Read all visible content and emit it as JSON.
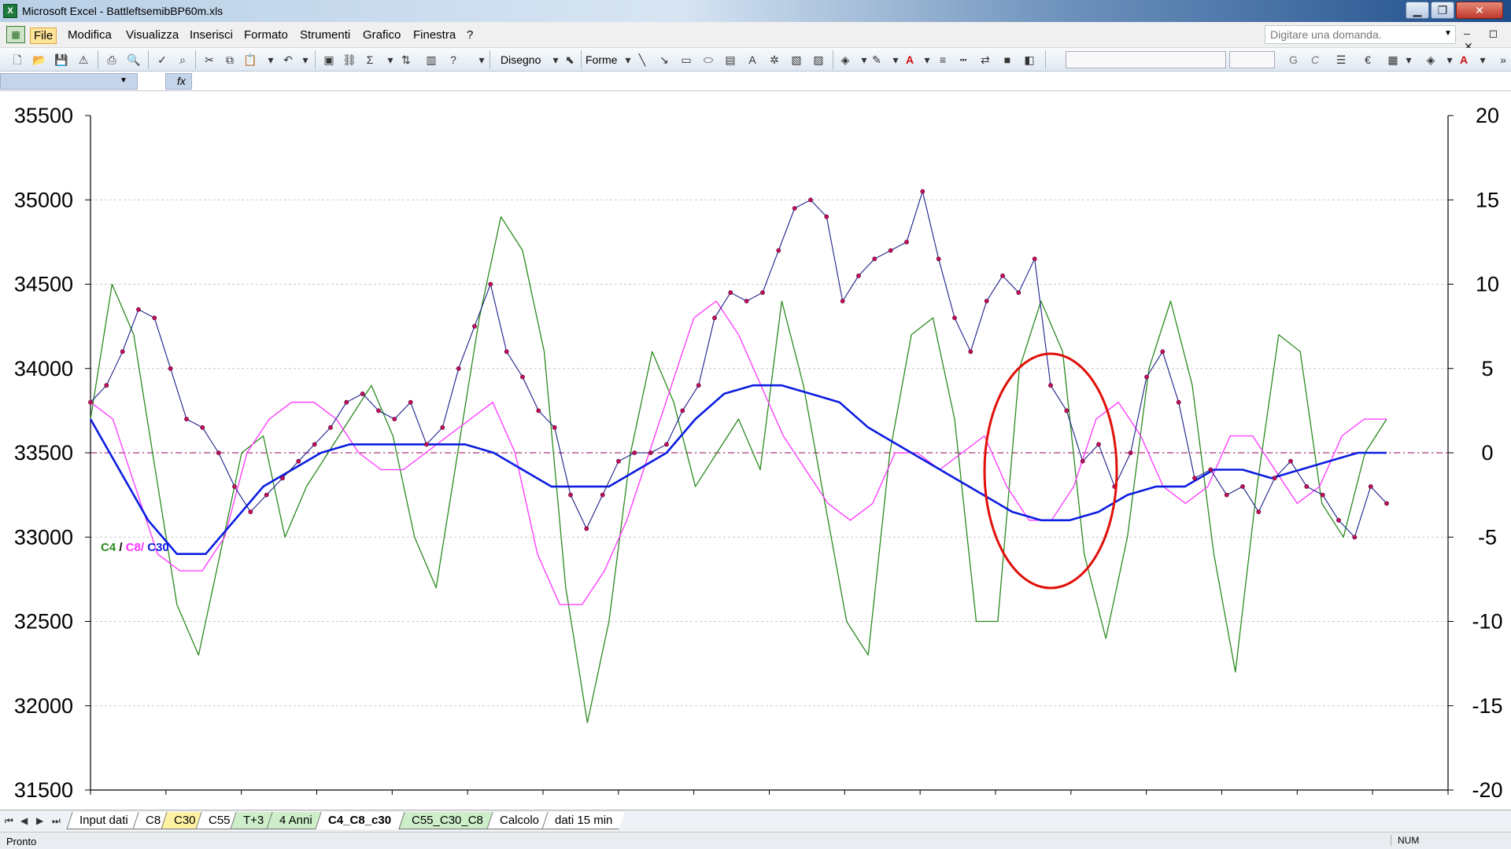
{
  "window": {
    "title": "Microsoft Excel - BattleftsemibBP60m.xls",
    "app_icon": "excel-icon",
    "controls": [
      "minimize-icon",
      "restore-icon",
      "close-icon"
    ]
  },
  "menubar": {
    "items": [
      "File",
      "Modifica",
      "Visualizza",
      "Inserisci",
      "Formato",
      "Strumenti",
      "Grafico",
      "Finestra",
      "?"
    ],
    "ask_placeholder": "Digitare una domanda.",
    "doc_controls": "– ◻ ✕"
  },
  "toolbar": {
    "draw_label": "Disegno",
    "shapes_label": "Forme",
    "bold_label": "G",
    "italic_label": "C"
  },
  "formulabar": {
    "fx_label": "fx"
  },
  "chart": {
    "type": "line",
    "ylim_left": [
      31500,
      35500
    ],
    "ylim_right": [
      -20,
      20
    ],
    "left_ticks": [
      "35500",
      "35000",
      "34500",
      "34000",
      "33500",
      "33000",
      "32500",
      "32000",
      "31500"
    ],
    "right_ticks": [
      "20",
      "15",
      "10",
      "5",
      "0",
      "-5",
      "-10",
      "-15",
      "-20"
    ],
    "legend": {
      "c4": "C4",
      "sep1": " / ",
      "c8": "C8/",
      "c30": " C30"
    },
    "colors": {
      "price": "#1c1f8a",
      "markers": "#c0105a",
      "c4": "#2a8a1e",
      "c8": "#ff33ff",
      "c30": "#0b1de0",
      "zero": "#a8347a",
      "circle": "#e0100a"
    },
    "grid": "horizontal dotted",
    "annotation": "red ellipse"
  },
  "chart_data": {
    "type": "line",
    "ylim": [
      31500,
      35500
    ],
    "y2lim": [
      -20,
      20
    ],
    "series": [
      {
        "axis": "left",
        "values": [
          33800,
          33900,
          34100,
          34350,
          34300,
          34000,
          33700,
          33650,
          33500,
          33300,
          33150,
          33250,
          33350,
          33450,
          33550,
          33650,
          33800,
          33850,
          33750,
          33700,
          33800,
          33550,
          33650,
          34000,
          34250,
          34500,
          34100,
          33950,
          33750,
          33650,
          33250,
          33050,
          33250,
          33450,
          33500,
          33500,
          33550,
          33750,
          33900,
          34300,
          34450,
          34400,
          34450,
          34700,
          34950,
          35000,
          34900,
          34400,
          34550,
          34650,
          34700,
          34750,
          35050,
          34650,
          34300,
          34100,
          34400,
          34550,
          34450,
          34650,
          33900,
          33750,
          33450,
          33550,
          33300,
          33500,
          33950,
          34100,
          33800,
          33350,
          33400,
          33250,
          33300,
          33150,
          33350,
          33450,
          33300,
          33250,
          33100,
          33000,
          33300,
          33200
        ]
      },
      {
        "name": "C4",
        "axis": "right",
        "values": [
          2,
          10,
          7,
          -1,
          -9,
          -12,
          -6,
          0,
          1,
          -5,
          -2,
          0,
          2,
          4,
          1,
          -5,
          -8,
          0,
          8,
          14,
          12,
          6,
          -8,
          -16,
          -10,
          0,
          6,
          3,
          -2,
          0,
          2,
          -1,
          9,
          4,
          -3,
          -10,
          -12,
          0,
          7,
          8,
          2,
          -10,
          -10,
          5,
          9,
          6,
          -6,
          -11,
          -5,
          5,
          9,
          4,
          -6,
          -13,
          -2,
          7,
          6,
          -3,
          -5,
          0,
          2
        ]
      },
      {
        "name": "C8",
        "axis": "right",
        "values": [
          3,
          2,
          -2,
          -6,
          -7,
          -7,
          -5,
          0,
          2,
          3,
          3,
          2,
          0,
          -1,
          -1,
          0,
          1,
          2,
          3,
          0,
          -6,
          -9,
          -9,
          -7,
          -4,
          0,
          4,
          8,
          9,
          7,
          4,
          1,
          -1,
          -3,
          -4,
          -3,
          0,
          0,
          -1,
          0,
          1,
          -2,
          -4,
          -4,
          -2,
          2,
          3,
          1,
          -2,
          -3,
          -2,
          1,
          1,
          -1,
          -3,
          -2,
          1,
          2,
          2
        ]
      },
      {
        "name": "C30",
        "axis": "right",
        "values": [
          2,
          -1,
          -4,
          -6,
          -6,
          -4,
          -2,
          -1,
          0,
          0.5,
          0.5,
          0.5,
          0.5,
          0.5,
          0,
          -1,
          -2,
          -2,
          -2,
          -1,
          0,
          2,
          3.5,
          4,
          4,
          3.5,
          3,
          1.5,
          0.5,
          -0.5,
          -1.5,
          -2.5,
          -3.5,
          -4,
          -4,
          -3.5,
          -2.5,
          -2,
          -2,
          -1,
          -1,
          -1.5,
          -1,
          -0.5,
          0,
          0
        ]
      }
    ]
  },
  "sheet_tabs": [
    "Input dati",
    "C8",
    "C30",
    "C55",
    "T+3",
    "4 Anni",
    "C4_C8_c30",
    "C55_C30_C8",
    "Calcolo",
    "dati 15 min"
  ],
  "status": {
    "left": "Pronto",
    "right": "NUM"
  }
}
